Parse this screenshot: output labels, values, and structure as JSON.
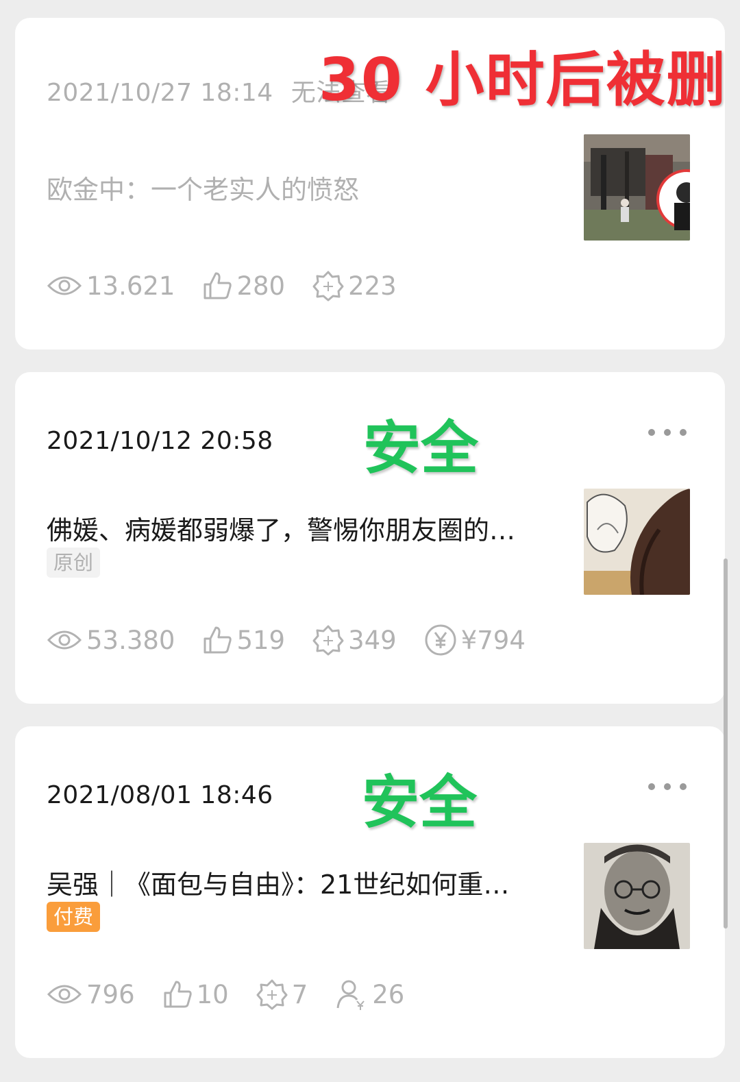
{
  "articles": [
    {
      "date": "2021/10/27 18:14",
      "status": "无法查看",
      "title": "欧金中：一个老实人的愤怒",
      "views": "13.621",
      "likes": "280",
      "wows": "223",
      "overlay": "30 小时后被删"
    },
    {
      "date": "2021/10/12 20:58",
      "title": "佛媛、病媛都弱爆了，警惕你朋友圈的…",
      "tag": "原创",
      "views": "53.380",
      "likes": "519",
      "wows": "349",
      "reward": "¥794",
      "overlay": "安全"
    },
    {
      "date": "2021/08/01 18:46",
      "title": "吴强｜《面包与自由》：21世纪如何重…",
      "tag": "付费",
      "views": "796",
      "likes": "10",
      "wows": "7",
      "paid_readers": "26",
      "overlay": "安全"
    }
  ],
  "colors": {
    "background": "#ededed",
    "card": "#ffffff",
    "text": "#1a1a1a",
    "muted": "#b2b2b2",
    "deleted_overlay": "#ef2f35",
    "safe_overlay": "#20c35a",
    "paid_tag": "#fa9d3b"
  },
  "icons": [
    "eye-icon",
    "thumbs-up-icon",
    "wow-star-icon",
    "yuan-coin-icon",
    "paid-reader-icon",
    "more-icon"
  ]
}
